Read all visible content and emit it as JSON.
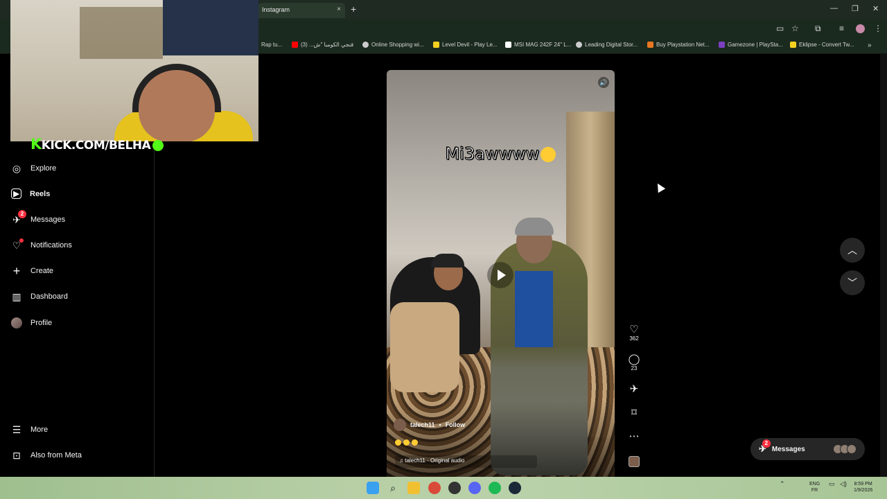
{
  "browser": {
    "tab_title": "Instagram",
    "tab_close": "×",
    "new_tab": "+",
    "window_controls": [
      "—",
      "❐",
      "✕"
    ],
    "bookmarks": [
      {
        "label": "Rap tu...",
        "color": "#888888"
      },
      {
        "label": "قنجي الكومبا \"ش... (3)",
        "color": "#ff0000"
      },
      {
        "label": "Online Shopping wi...",
        "color": "#cccccc"
      },
      {
        "label": "Level Devil - Play Le...",
        "color": "#f5d020"
      },
      {
        "label": "MSI MAG 242F 24\" L...",
        "color": "#000000"
      },
      {
        "label": "Leading Digital Stor...",
        "color": "#cccccc"
      },
      {
        "label": "Buy Playstation Net...",
        "color": "#e87722"
      },
      {
        "label": "Gamezone | PlaySta...",
        "color": "#7b3fbf"
      },
      {
        "label": "Eklipse - Convert Tw...",
        "color": "#f5d020"
      }
    ],
    "bookmarks_overflow": "»"
  },
  "overlay": {
    "kick_k": "K",
    "kick_text": "KICK.COM/BELHA"
  },
  "sidebar": {
    "items": [
      {
        "label": "Explore",
        "icon": "◎",
        "name": "explore"
      },
      {
        "label": "Reels",
        "icon": "▶",
        "name": "reels",
        "bold": true
      },
      {
        "label": "Messages",
        "icon": "✈",
        "name": "messages",
        "badge": "2"
      },
      {
        "label": "Notifications",
        "icon": "♡",
        "name": "notifications",
        "dot": true
      },
      {
        "label": "Create",
        "icon": "+",
        "name": "create"
      },
      {
        "label": "Dashboard",
        "icon": "▥",
        "name": "dashboard"
      },
      {
        "label": "Profile",
        "icon": "",
        "name": "profile"
      }
    ],
    "more": {
      "label": "More",
      "icon": "☰"
    },
    "meta": {
      "label": "Also from Meta",
      "icon": "⊡"
    }
  },
  "reel": {
    "caption": "Mi3awwww",
    "author": "talech11",
    "separator": "•",
    "follow": "Follow",
    "audio": "♫ talech11 · Original audio",
    "likes": "362",
    "comments": "23"
  },
  "messages_pill": {
    "label": "Messages",
    "badge": "2"
  },
  "taskbar": {
    "lang_top": "ENG",
    "lang_bottom": "FR",
    "time": "8:59 PM",
    "date": "1/9/2026"
  },
  "colors": {
    "accent_notification": "#ff3040",
    "kick_green": "#53fc18",
    "panel": "#262626"
  }
}
